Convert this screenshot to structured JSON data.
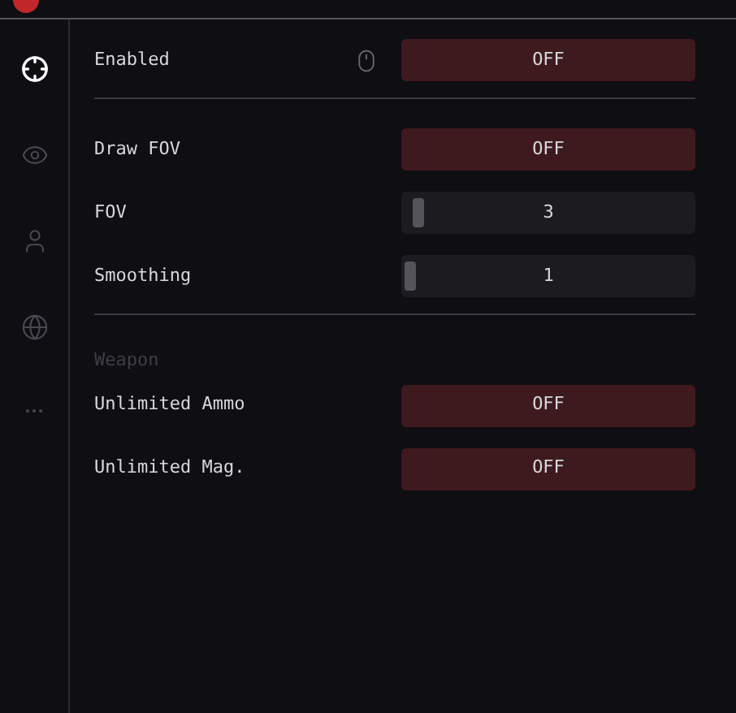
{
  "sidebar": {
    "items": [
      {
        "kind": "crosshair",
        "selected": true
      },
      {
        "kind": "eye",
        "selected": false
      },
      {
        "kind": "user",
        "selected": false
      },
      {
        "kind": "globe",
        "selected": false
      },
      {
        "kind": "more",
        "selected": false
      }
    ]
  },
  "sections": [
    {
      "rows": [
        {
          "kind": "toggle",
          "label": "Enabled",
          "keybind": true,
          "on": false,
          "value": "OFF"
        }
      ]
    },
    {
      "rows": [
        {
          "kind": "toggle",
          "label": "Draw FOV",
          "on": false,
          "value": "OFF"
        },
        {
          "kind": "slider",
          "label": "FOV",
          "level": 0.03,
          "value": "3"
        },
        {
          "kind": "slider",
          "label": "Smoothing",
          "level": 0.0,
          "value": "1"
        }
      ]
    },
    {
      "title": "Weapon",
      "rows": [
        {
          "kind": "toggle",
          "label": "Unlimited Ammo",
          "on": false,
          "value": "OFF"
        },
        {
          "kind": "toggle",
          "label": "Unlimited Mag.",
          "on": false,
          "value": "OFF"
        }
      ]
    }
  ]
}
